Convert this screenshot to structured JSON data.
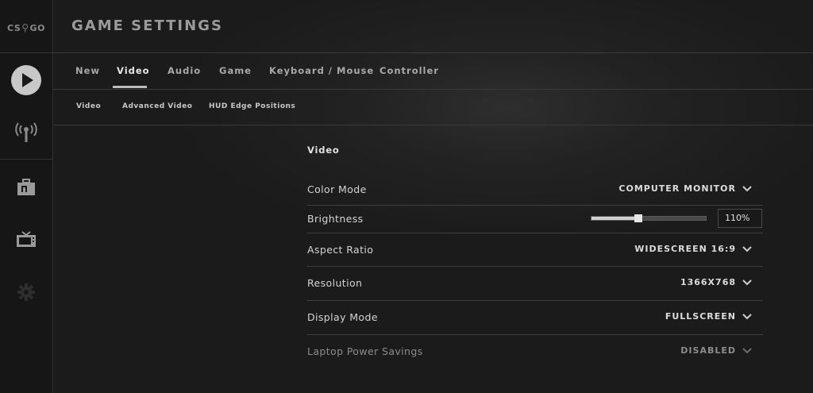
{
  "app": {
    "logo_left": "CS",
    "logo_mid": "⚲",
    "logo_right": "GO"
  },
  "header": {
    "title": "GAME SETTINGS"
  },
  "rail": {
    "items": [
      {
        "icon": "play-icon"
      },
      {
        "icon": "broadcast-icon"
      },
      {
        "icon": "briefcase-icon"
      },
      {
        "icon": "tv-icon"
      },
      {
        "icon": "gear-icon"
      }
    ]
  },
  "tabs": [
    {
      "label": "New",
      "active": false
    },
    {
      "label": "Video",
      "active": true
    },
    {
      "label": "Audio",
      "active": false
    },
    {
      "label": "Game",
      "active": false
    },
    {
      "label": "Keyboard / Mouse",
      "active": false
    },
    {
      "label": "Controller",
      "active": false
    }
  ],
  "subtabs": [
    {
      "label": "Video"
    },
    {
      "label": "Advanced Video"
    },
    {
      "label": "HUD Edge Positions"
    }
  ],
  "section": {
    "title": "Video"
  },
  "settings": {
    "color_mode": {
      "label": "Color Mode",
      "value": "COMPUTER MONITOR"
    },
    "brightness": {
      "label": "Brightness",
      "value": "110%",
      "fraction": 0.41
    },
    "aspect_ratio": {
      "label": "Aspect Ratio",
      "value": "WIDESCREEN 16:9"
    },
    "resolution": {
      "label": "Resolution",
      "value": "1366X768"
    },
    "display_mode": {
      "label": "Display Mode",
      "value": "FULLSCREEN"
    },
    "laptop_power": {
      "label": "Laptop Power Savings",
      "value": "DISABLED",
      "disabled": true
    }
  },
  "colors": {
    "background": "#1b1b1b",
    "rail": "#161616",
    "accent": "#e6e6e6",
    "divider": "#3a3a3a"
  }
}
